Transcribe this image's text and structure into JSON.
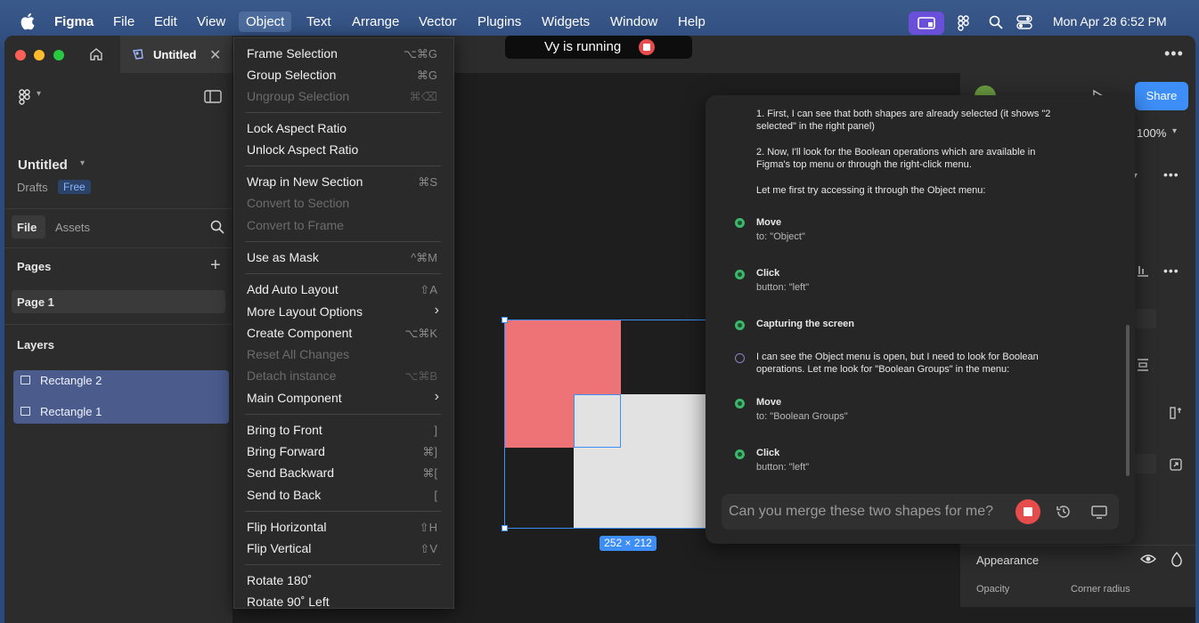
{
  "menubar": {
    "app_name": "Figma",
    "items": [
      "File",
      "Edit",
      "View",
      "Object",
      "Text",
      "Arrange",
      "Vector",
      "Plugins",
      "Widgets",
      "Window",
      "Help"
    ],
    "active_item": "Object",
    "datetime": "Mon Apr 28  6:52 PM"
  },
  "tab": {
    "title": "Untitled"
  },
  "vy_banner": {
    "text": "Vy is running"
  },
  "sidebar": {
    "file_name": "Untitled",
    "location": "Drafts",
    "plan_badge": "Free",
    "tabs": [
      "File",
      "Assets"
    ],
    "pages_label": "Pages",
    "page": "Page 1",
    "layers_label": "Layers",
    "layers": [
      "Rectangle 2",
      "Rectangle 1"
    ]
  },
  "object_menu": {
    "items": [
      {
        "label": "Frame Selection",
        "shortcut": "⌥⌘G",
        "disabled": false
      },
      {
        "label": "Group Selection",
        "shortcut": "⌘G",
        "disabled": false
      },
      {
        "label": "Ungroup Selection",
        "shortcut": "⌘⌫",
        "disabled": true
      },
      {
        "label": "Lock Aspect Ratio",
        "shortcut": "",
        "disabled": false
      },
      {
        "label": "Unlock Aspect Ratio",
        "shortcut": "",
        "disabled": false
      },
      {
        "label": "Wrap in New Section",
        "shortcut": "⌘S",
        "disabled": false
      },
      {
        "label": "Convert to Section",
        "shortcut": "",
        "disabled": true
      },
      {
        "label": "Convert to Frame",
        "shortcut": "",
        "disabled": true
      },
      {
        "label": "Use as Mask",
        "shortcut": "^⌘M",
        "disabled": false
      },
      {
        "label": "Add Auto Layout",
        "shortcut": "⇧A",
        "disabled": false
      },
      {
        "label": "More Layout Options",
        "shortcut": "",
        "disabled": false
      },
      {
        "label": "Create Component",
        "shortcut": "⌥⌘K",
        "disabled": false
      },
      {
        "label": "Reset All Changes",
        "shortcut": "",
        "disabled": true
      },
      {
        "label": "Detach instance",
        "shortcut": "⌥⌘B",
        "disabled": true
      },
      {
        "label": "Main Component",
        "shortcut": "",
        "disabled": false
      },
      {
        "label": "Bring to Front",
        "shortcut": "]",
        "disabled": false
      },
      {
        "label": "Bring Forward",
        "shortcut": "⌘]",
        "disabled": false
      },
      {
        "label": "Send Backward",
        "shortcut": "⌘[",
        "disabled": false
      },
      {
        "label": "Send to Back",
        "shortcut": "[",
        "disabled": false
      },
      {
        "label": "Flip Horizontal",
        "shortcut": "⇧H",
        "disabled": false
      },
      {
        "label": "Flip Vertical",
        "shortcut": "⇧V",
        "disabled": false
      },
      {
        "label": "Rotate 180˚",
        "shortcut": "",
        "disabled": false
      },
      {
        "label": "Rotate 90˚ Left",
        "shortcut": "",
        "disabled": false
      }
    ]
  },
  "canvas": {
    "selection_size": "252 × 212"
  },
  "right_panel": {
    "share_label": "Share",
    "zoom": "100%",
    "appearance_label": "Appearance",
    "opacity_label": "Opacity",
    "corner_radius_label": "Corner radius"
  },
  "vy_panel": {
    "intro_1a": "1. First, I can see that both shapes are already selected (it shows \"2",
    "intro_1b": "selected\" in the right panel)",
    "intro_2a": "2. Now, I'll look for the Boolean operations which are available in",
    "intro_2b": "Figma's top menu or through the right-click menu.",
    "intro_3": "Let me first try accessing it through the Object menu:",
    "steps": [
      {
        "title": "Move",
        "detail": "to: \"Object\""
      },
      {
        "title": "Click",
        "detail": "button: \"left\""
      },
      {
        "title": "Capturing the screen",
        "detail": ""
      },
      {
        "title": "Move",
        "detail": "to: \"Boolean Groups\""
      },
      {
        "title": "Click",
        "detail": "button: \"left\""
      }
    ],
    "thought_a": "I can see the Object menu is open, but I need to look for Boolean",
    "thought_b": "operations. Let me look for \"Boolean Groups\" in the menu:",
    "input_text": "Can you merge these two shapes for me?"
  },
  "colors": {
    "accent": "#3d8ef7",
    "rect_red": "#ee7377",
    "rect_grey": "#e2e2e2",
    "stop_red": "#e74c4c",
    "step_green": "#3bb86a"
  }
}
